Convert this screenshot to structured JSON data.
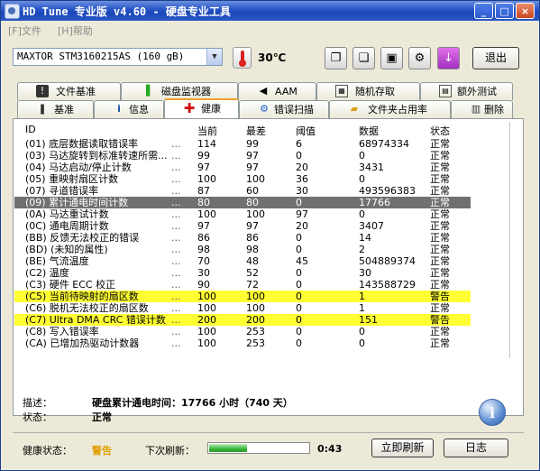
{
  "window": {
    "title": "HD Tune 专业版 v4.60 - 硬盘专业工具",
    "controls": [
      "_",
      "□",
      "×"
    ]
  },
  "menu": {
    "file": "[F]文件",
    "help": "[H]帮助"
  },
  "toolbar": {
    "drive": "MAXTOR STM3160215AS (160 gB)",
    "temperature": "30℃",
    "exit_label": "退出",
    "icons": [
      "copy-icon",
      "copy-text-icon",
      "save-icon",
      "options-icon",
      "download-icon"
    ]
  },
  "tabs_top": [
    {
      "label": "文件基准",
      "icon": "info-icon"
    },
    {
      "label": "磁盘监视器",
      "icon": "monitor-chart-icon"
    },
    {
      "label": "AAM",
      "icon": "speaker-icon"
    },
    {
      "label": "随机存取",
      "icon": "random-access-icon"
    },
    {
      "label": "额外测试",
      "icon": "extra-tests-icon"
    }
  ],
  "tabs_bottom": [
    {
      "label": "基准",
      "icon": "benchmark-icon"
    },
    {
      "label": "信息",
      "icon": "info-icon"
    },
    {
      "label": "健康",
      "icon": "health-cross-icon",
      "active": true
    },
    {
      "label": "错误扫描",
      "icon": "error-scan-icon"
    },
    {
      "label": "文件夹占用率",
      "icon": "folder-icon"
    },
    {
      "label": "删除",
      "icon": "trash-icon"
    }
  ],
  "table": {
    "headers": [
      "ID",
      "当前",
      "最差",
      "阈值",
      "数据",
      "状态"
    ],
    "rows": [
      {
        "id": "(01) 底层数据读取错误率",
        "current": "114",
        "worst": "99",
        "threshold": "6",
        "data": "68974334",
        "status": "正常"
      },
      {
        "id": "(03) 马达旋转到标准转速所需...",
        "current": "99",
        "worst": "97",
        "threshold": "0",
        "data": "0",
        "status": "正常"
      },
      {
        "id": "(04) 马达启动/停止计数",
        "current": "97",
        "worst": "97",
        "threshold": "20",
        "data": "3431",
        "status": "正常"
      },
      {
        "id": "(05) 重映射扇区计数",
        "current": "100",
        "worst": "100",
        "threshold": "36",
        "data": "0",
        "status": "正常"
      },
      {
        "id": "(07) 寻道错误率",
        "current": "87",
        "worst": "60",
        "threshold": "30",
        "data": "493596383",
        "status": "正常"
      },
      {
        "id": "(09) 累计通电时间计数",
        "current": "80",
        "worst": "80",
        "threshold": "0",
        "data": "17766",
        "status": "正常",
        "highlight": "gray"
      },
      {
        "id": "(0A) 马达重试计数",
        "current": "100",
        "worst": "100",
        "threshold": "97",
        "data": "0",
        "status": "正常"
      },
      {
        "id": "(0C) 通电周期计数",
        "current": "97",
        "worst": "97",
        "threshold": "20",
        "data": "3407",
        "status": "正常"
      },
      {
        "id": "(BB) 反馈无法校正的错误",
        "current": "86",
        "worst": "86",
        "threshold": "0",
        "data": "14",
        "status": "正常"
      },
      {
        "id": "(BD) (未知的属性)",
        "current": "98",
        "worst": "98",
        "threshold": "0",
        "data": "2",
        "status": "正常"
      },
      {
        "id": "(BE) 气流温度",
        "current": "70",
        "worst": "48",
        "threshold": "45",
        "data": "504889374",
        "status": "正常"
      },
      {
        "id": "(C2) 温度",
        "current": "30",
        "worst": "52",
        "threshold": "0",
        "data": "30",
        "status": "正常"
      },
      {
        "id": "(C3) 硬件 ECC 校正",
        "current": "90",
        "worst": "72",
        "threshold": "0",
        "data": "143588729",
        "status": "正常"
      },
      {
        "id": "(C5) 当前待映射的扇区数",
        "current": "100",
        "worst": "100",
        "threshold": "0",
        "data": "1",
        "status": "警告",
        "highlight": "yellow"
      },
      {
        "id": "(C6) 脱机无法校正的扇区数",
        "current": "100",
        "worst": "100",
        "threshold": "0",
        "data": "1",
        "status": "正常"
      },
      {
        "id": "(C7) Ultra DMA CRC 错误计数",
        "current": "200",
        "worst": "200",
        "threshold": "0",
        "data": "151",
        "status": "警告",
        "highlight": "yellow"
      },
      {
        "id": "(C8) 写入错误率",
        "current": "100",
        "worst": "253",
        "threshold": "0",
        "data": "0",
        "status": "正常"
      },
      {
        "id": "(CA) 已增加热驱动计数器",
        "current": "100",
        "worst": "253",
        "threshold": "0",
        "data": "0",
        "status": "正常"
      }
    ]
  },
  "description": {
    "desc_label": "描述：",
    "desc_value": "硬盘累计通电时间：17766 小时（740 天）",
    "status_label": "状态：",
    "status_value": "正常"
  },
  "footer": {
    "health_label": "健康状态：",
    "health_value": "警告",
    "next_refresh_label": "下次刷新：",
    "progress": 0.38,
    "countdown": "0:43",
    "refresh_button": "立即刷新",
    "log_button": "日志"
  },
  "colors": {
    "title_bar": "#2b59c8",
    "highlight_gray": "#707070",
    "highlight_yellow": "#ffff33",
    "warning_text": "#e0a000",
    "progress_green": "#3cb43c"
  }
}
